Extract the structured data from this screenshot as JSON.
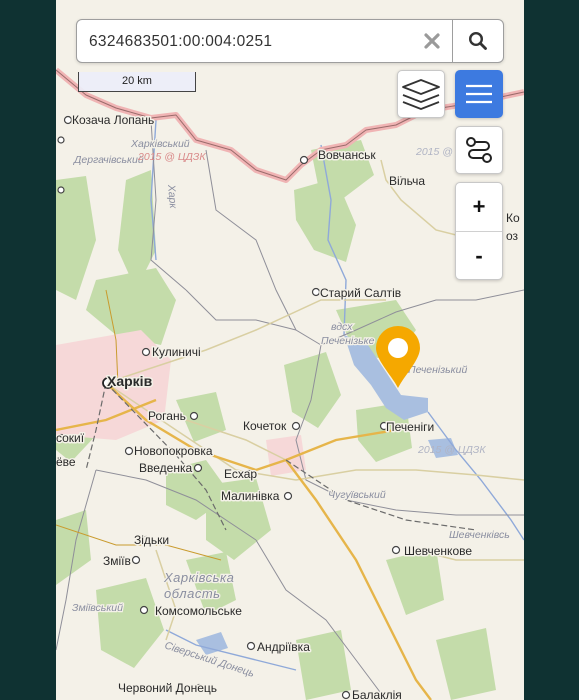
{
  "search": {
    "value": "6324683501:00:004:0251"
  },
  "scale": {
    "label": "20 km"
  },
  "zoom": {
    "in_label": "+",
    "out_label": "-"
  },
  "marker": {
    "color": "#f5a800"
  },
  "accent": "#3d7ae0",
  "places": [
    {
      "id": "kozacha-lopan",
      "name": "Козача Лопань"
    },
    {
      "id": "vovchansk",
      "name": "Вовчанськ"
    },
    {
      "id": "vilcha",
      "name": "Вільча"
    },
    {
      "id": "staryi-saltiv",
      "name": "Старий Салтів"
    },
    {
      "id": "kulynychi",
      "name": "Кулиничі"
    },
    {
      "id": "kharkiv",
      "name": "Харків"
    },
    {
      "id": "rohan",
      "name": "Рогань"
    },
    {
      "id": "kochetok",
      "name": "Кочеток"
    },
    {
      "id": "pechenihy",
      "name": "Печеніги"
    },
    {
      "id": "novopokrovka",
      "name": "Новопокровка"
    },
    {
      "id": "vvedenka",
      "name": "Введенка"
    },
    {
      "id": "eskhar",
      "name": "Есхар"
    },
    {
      "id": "malynivka",
      "name": "Малинівка"
    },
    {
      "id": "zidky",
      "name": "Зідьки"
    },
    {
      "id": "zmiiv",
      "name": "Зміїв"
    },
    {
      "id": "komsomolske",
      "name": "Комсомольське"
    },
    {
      "id": "shevchenkove",
      "name": "Шевченкове"
    },
    {
      "id": "andriivka",
      "name": "Андріївка"
    },
    {
      "id": "chervonyi-donets",
      "name": "Червоний Донець"
    },
    {
      "id": "balakliia",
      "name": "Балаклія"
    },
    {
      "id": "sokil",
      "name": "сокиї"
    },
    {
      "id": "vybe",
      "name": "ёве"
    },
    {
      "id": "ko",
      "name": "Ко"
    },
    {
      "id": "ozero",
      "name": "оз"
    }
  ],
  "regions": [
    {
      "id": "kharkivskyi-ru",
      "name": "Харківський"
    },
    {
      "id": "derhachivskyi",
      "name": "Дергачівський"
    },
    {
      "id": "khark",
      "name": "Харк"
    },
    {
      "id": "pechenizkyi",
      "name": "Печенізький"
    },
    {
      "id": "chuhuivskyi",
      "name": "Чугуївський"
    },
    {
      "id": "shevchenkivskyi",
      "name": "Шевченківсь"
    },
    {
      "id": "oblast-1",
      "name": "Харківська"
    },
    {
      "id": "oblast-2",
      "name": "область"
    },
    {
      "id": "zmiivskyi",
      "name": "Зміївський"
    },
    {
      "id": "vdskh-1",
      "name": "вдсх"
    },
    {
      "id": "vdskh-2",
      "name": "Печенізьке"
    },
    {
      "id": "siverskyi",
      "name": "Сіверський Донець"
    }
  ],
  "watermarks": [
    {
      "id": "wm-1",
      "name": "2015 @ ЦДЗК"
    },
    {
      "id": "wm-2",
      "name": "2015 @ ЦДЗК"
    },
    {
      "id": "wm-3",
      "name": "2015 @ ЦДЗК"
    }
  ]
}
